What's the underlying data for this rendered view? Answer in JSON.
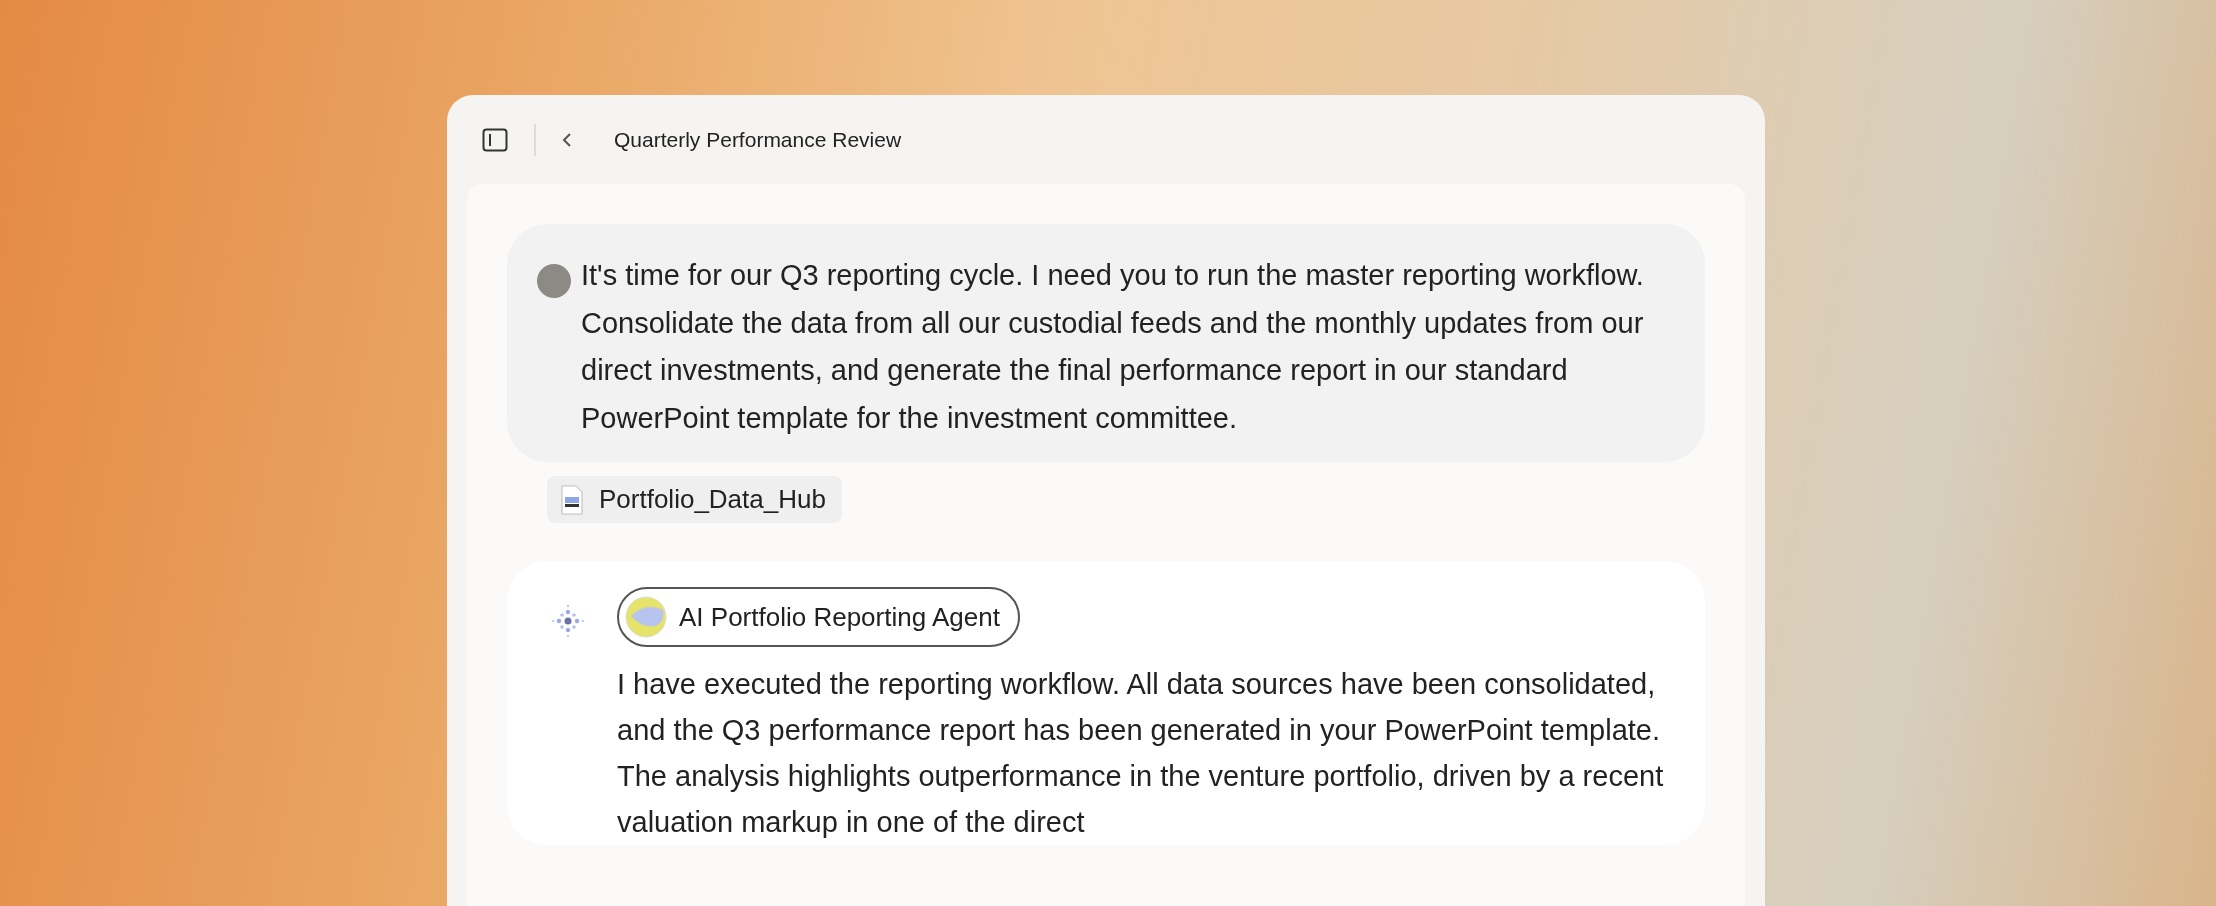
{
  "window": {
    "title": "Quarterly Performance Review"
  },
  "user_message": {
    "text": "It's time for our Q3 reporting cycle. I need you to run the master reporting workflow. Consolidate the data from all our custodial feeds and the monthly updates from our direct investments, and generate the final performance report in our standard PowerPoint template for the investment committee."
  },
  "attachments": [
    {
      "name": "Portfolio_Data_Hub"
    }
  ],
  "agent_message": {
    "agent": "AI Portfolio Reporting Agent",
    "text": "I have executed the reporting workflow. All data sources have been consolidated, and the Q3 performance report has been generated in your PowerPoint template. The analysis highlights outperformance in the venture portfolio, driven by a recent valuation markup in one of the direct"
  }
}
